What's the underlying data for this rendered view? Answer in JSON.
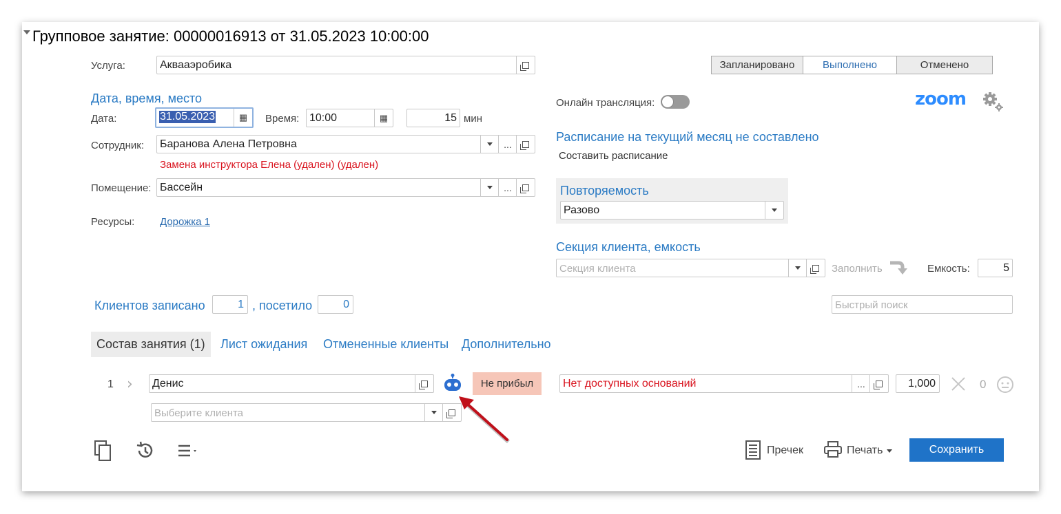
{
  "title": "Групповое занятие: 00000016913 от 31.05.2023 10:00:00",
  "service": {
    "label": "Услуга:",
    "value": "Аквааэробика"
  },
  "status_buttons": [
    "Запланировано",
    "Выполнено",
    "Отменено"
  ],
  "status_active": "Выполнено",
  "datetime_section": {
    "title": "Дата, время, место"
  },
  "date": {
    "label": "Дата:",
    "value": "31.05.2023"
  },
  "time": {
    "label": "Время:",
    "value": "10:00"
  },
  "duration": {
    "value": "15",
    "unit": "мин"
  },
  "employee": {
    "label": "Сотрудник:",
    "value": "Баранова Алена Петровна",
    "warning": "Замена инструктора Елена (удален) (удален)"
  },
  "room": {
    "label": "Помещение:",
    "value": "Бассейн"
  },
  "resources": {
    "label": "Ресурсы:",
    "link": "Дорожка 1"
  },
  "online": {
    "label": "Онлайн трансляция:",
    "enabled": false
  },
  "zoom": {
    "logo": "zoom",
    "settings_icon": "gears-icon"
  },
  "schedule": {
    "title": "Расписание на текущий месяц не составлено",
    "action": "Составить расписание"
  },
  "repeat": {
    "title": "Повторяемость",
    "value": "Разово"
  },
  "section": {
    "title": "Секция клиента, емкость",
    "placeholder": "Секция клиента",
    "fill_label": "Заполнить",
    "capacity_label": "Емкость:",
    "capacity_value": "5"
  },
  "clients": {
    "registered_label": "Клиентов записано",
    "registered_value": "1",
    "visited_label": ", посетило",
    "visited_value": "0"
  },
  "quick_search": {
    "placeholder": "Быстрый поиск"
  },
  "tabs": [
    {
      "label": "Состав занятия (1)",
      "active": true
    },
    {
      "label": "Лист ожидания",
      "active": false
    },
    {
      "label": "Отмененные клиенты",
      "active": false
    },
    {
      "label": "Дополнительно",
      "active": false
    }
  ],
  "row": {
    "num": "1",
    "client": "Денис",
    "status": "Не прибыл",
    "basis": "Нет доступных оснований",
    "qty": "1,000",
    "count": "0"
  },
  "new_client": {
    "placeholder": "Выберите клиента"
  },
  "footer": {
    "receipt": "Пречек",
    "print": "Печать",
    "save": "Сохранить"
  },
  "colors": {
    "accent": "#1f73c8",
    "link": "#2b7bc4",
    "warning": "#d9141f",
    "badge": "#f6c6b8",
    "arrow": "#c0101a"
  }
}
